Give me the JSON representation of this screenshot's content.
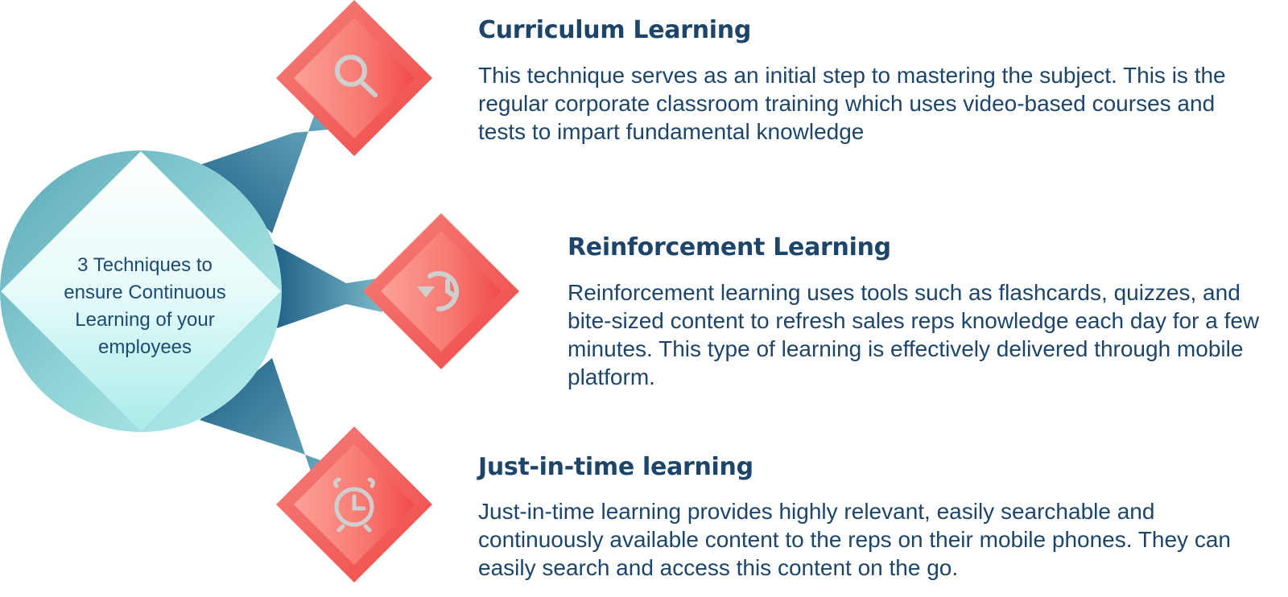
{
  "center": {
    "lines": [
      "3 Techniques to",
      "ensure Continuous",
      "Learning of your",
      "employees"
    ]
  },
  "items": [
    {
      "title": "Curriculum Learning",
      "icon": "search-icon",
      "description": "This technique serves as an initial step to mastering the subject. This is the regular corporate classroom training which uses video-based courses and tests to impart fundamental knowledge"
    },
    {
      "title": "Reinforcement Learning",
      "icon": "history-icon",
      "description": "Reinforcement learning uses tools such as flashcards, quizzes, and bite-sized content to refresh sales reps knowledge each day for a few minutes. This type of learning is effectively delivered through mobile platform."
    },
    {
      "title": "Just-in-time learning",
      "icon": "alarm-clock-icon",
      "description": "Just-in-time learning provides highly relevant, easily searchable and continuously available content to the reps on their mobile phones. They can easily search and access this content on the go."
    }
  ],
  "colors": {
    "title_text": "#1d4569",
    "diamond_red": "#f0514f",
    "diamond_light": "#fa9d94",
    "connector_dark": "#1f5f86",
    "connector_light": "#6fb0c3",
    "circle_teal": "#6fb8c6",
    "circle_light": "#c9f3f3"
  }
}
